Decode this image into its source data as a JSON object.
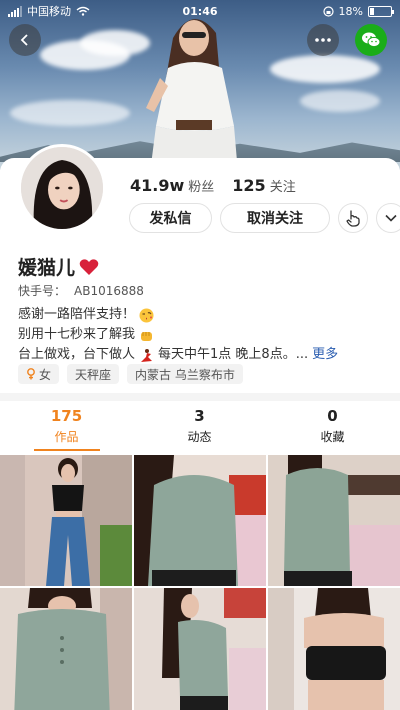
{
  "status_bar": {
    "carrier": "中国移动",
    "time": "01:46",
    "battery": "18%",
    "battery_level": 0.18
  },
  "profile": {
    "fans_count": "41.9w",
    "fans_label": "粉丝",
    "follow_count": "125",
    "follow_label": "关注",
    "name": "媛猫儿",
    "kuaishou_id_label": "快手号：",
    "kuaishou_id": "AB1016888",
    "bio_lines": [
      "感谢一路陪伴支持！",
      "别用十七秒来了解我",
      "台上做戏，台下做人",
      "每天中午1点 晚上8点。..."
    ],
    "more_label": "更多"
  },
  "actions": {
    "message_label": "发私信",
    "unfollow_label": "取消关注"
  },
  "tags": {
    "gender": "女",
    "zodiac": "天秤座",
    "location": "内蒙古 乌兰察布市"
  },
  "tabs": [
    {
      "count": "175",
      "label": "作品",
      "active": true
    },
    {
      "count": "3",
      "label": "动态",
      "active": false
    },
    {
      "count": "0",
      "label": "收藏",
      "active": false
    }
  ],
  "colors": {
    "accent": "#f0831e",
    "link": "#2a5db0",
    "wechat": "#1aad19",
    "heart": "#d8213a"
  },
  "icons": {
    "back": "chevron-left-icon",
    "more": "more-dots-icon",
    "share": "wechat-icon",
    "poke": "hand-pointer-icon",
    "expand": "chevron-down-icon",
    "gender": "female-icon"
  }
}
